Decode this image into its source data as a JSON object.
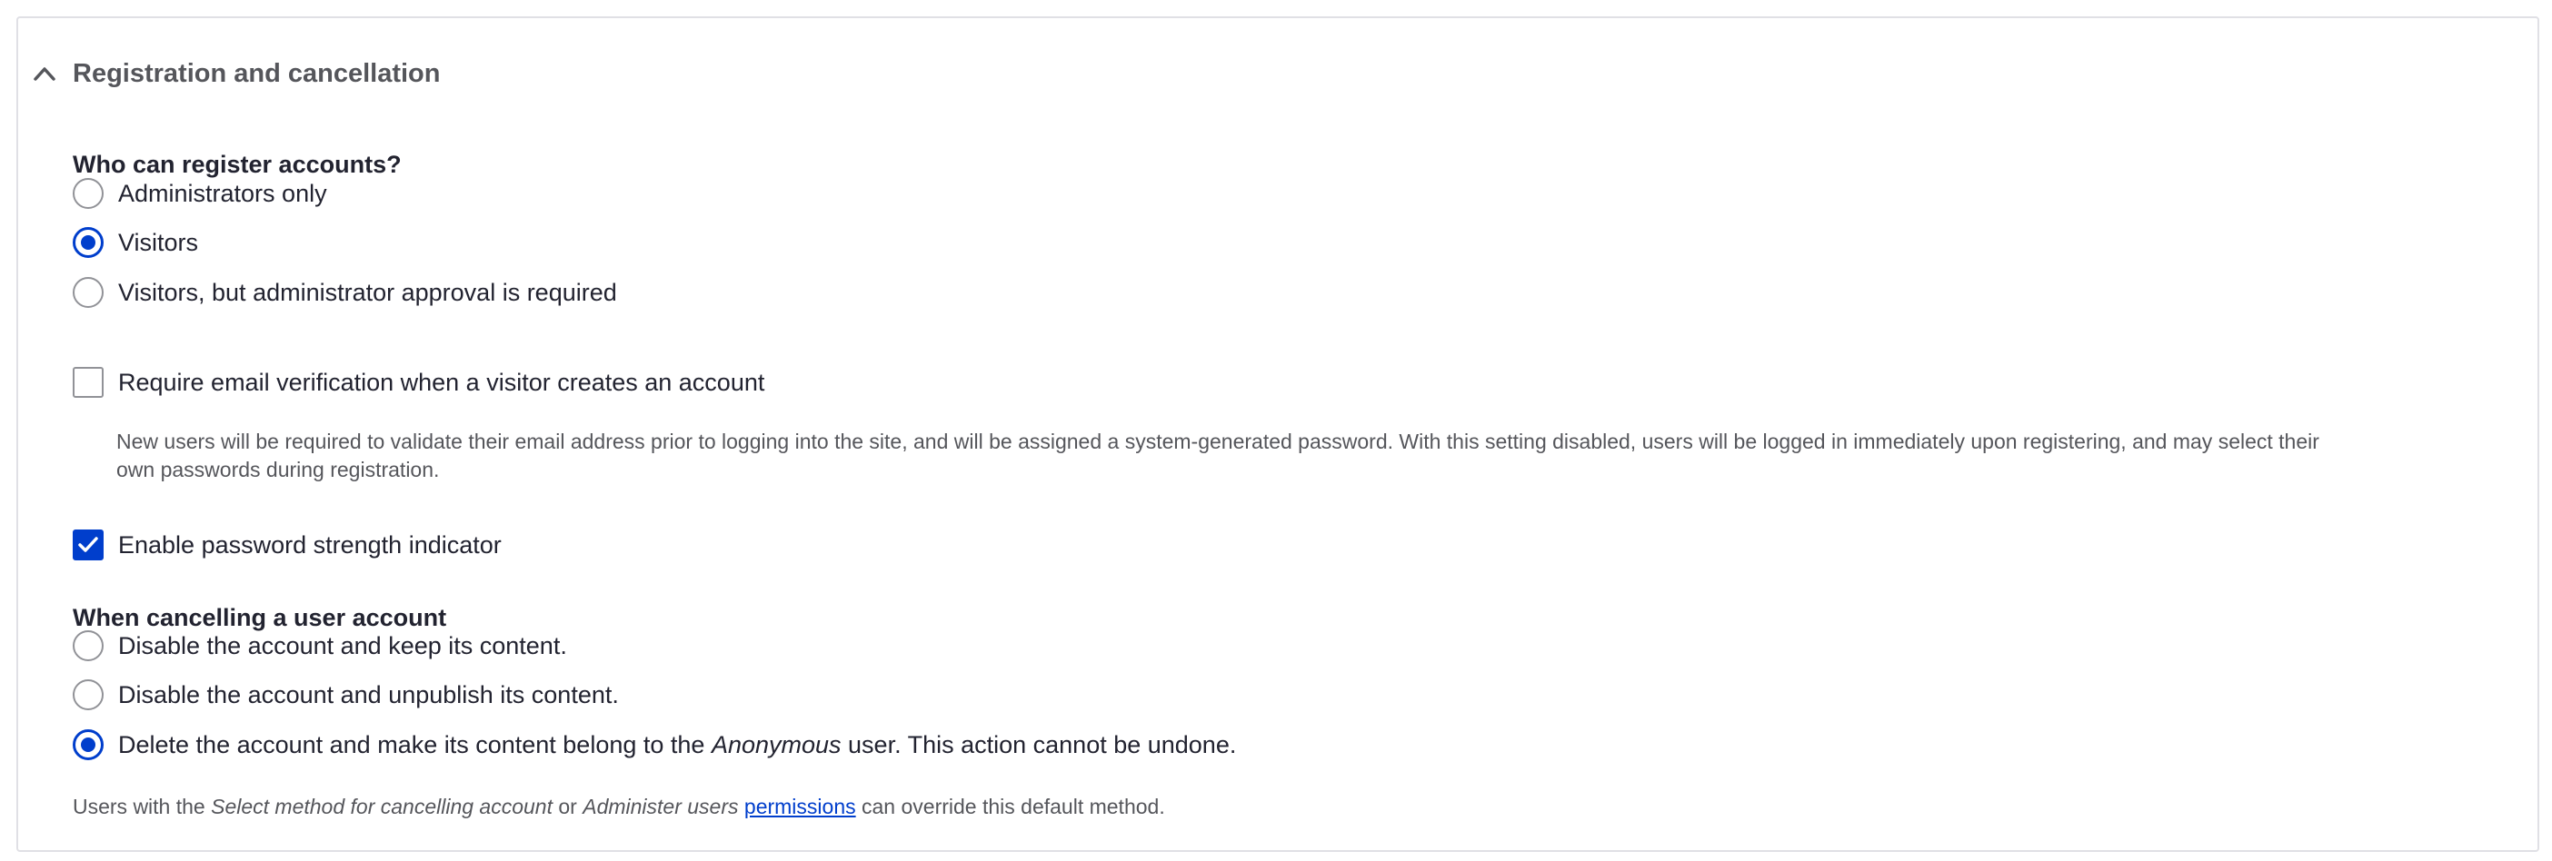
{
  "section": {
    "title": "Registration and cancellation",
    "expanded": true,
    "toggle_icon": "chevron-up-icon"
  },
  "registration": {
    "label": "Who can register accounts?",
    "options": [
      {
        "label": "Administrators only",
        "checked": false
      },
      {
        "label": "Visitors",
        "checked": true
      },
      {
        "label": "Visitors, but administrator approval is required",
        "checked": false
      }
    ]
  },
  "email_verification": {
    "label": "Require email verification when a visitor creates an account",
    "checked": false,
    "description_line1": "New users will be required to validate their email address prior to logging into the site, and will be assigned a system-generated password. With this setting disabled, users will be logged in immediately upon registering, and may select their",
    "description_line2": "own passwords during registration."
  },
  "password_strength": {
    "label": "Enable password strength indicator",
    "checked": true
  },
  "cancellation": {
    "label": "When cancelling a user account",
    "options": [
      {
        "label": "Disable the account and keep its content.",
        "checked": false
      },
      {
        "label": "Disable the account and unpublish its content.",
        "checked": false
      },
      {
        "label_before": "Delete the account and make its content belong to the ",
        "label_em": "Anonymous",
        "label_after": " user. This action cannot be undone.",
        "checked": true
      }
    ],
    "help": {
      "text1": "Users with the ",
      "em1": "Select method for cancelling account",
      "text2": " or ",
      "em2": "Administer users",
      "text3": " ",
      "link": "permissions",
      "text4": " can override this default method."
    }
  },
  "colors": {
    "accent": "#003ecc",
    "text": "#222330",
    "muted": "#55565b",
    "border": "#919297"
  }
}
